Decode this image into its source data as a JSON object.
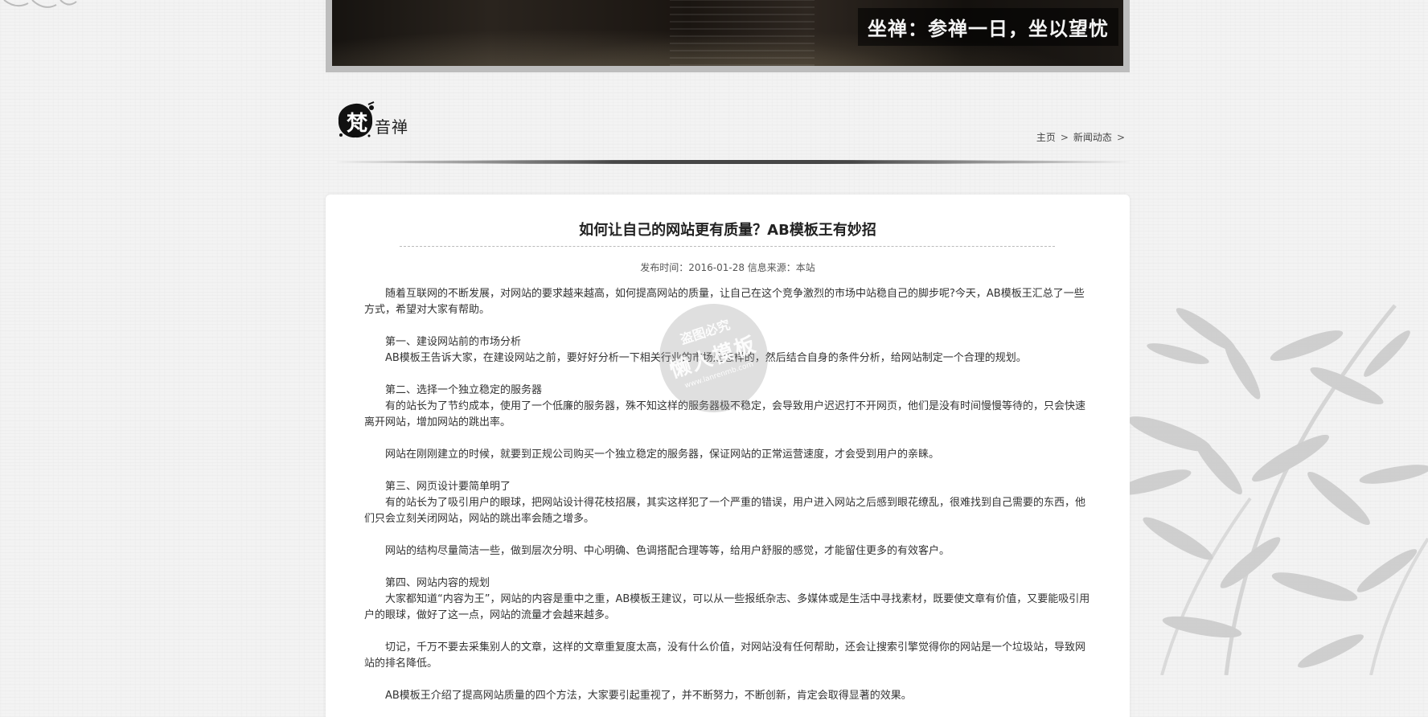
{
  "banner": {
    "caption": "坐禅：参禅一日，坐以望忧"
  },
  "logo": {
    "char": "梵",
    "text": "音禅"
  },
  "breadcrumb": {
    "items": [
      "主页",
      "新闻动态"
    ],
    "separator": ">"
  },
  "article": {
    "title": "如何让自己的网站更有质量？AB模板王有妙招",
    "meta": "发布时间：2016-01-28 信息来源：本站",
    "paragraphs": [
      {
        "text": "随着互联网的不断发展，对网站的要求越来越高，如何提高网站的质量，让自己在这个竞争激烈的市场中站稳自己的脚步呢?今天，AB模板王汇总了一些方式，希望对大家有帮助。",
        "gap": false
      },
      {
        "text": "第一、建设网站前的市场分析",
        "gap": true
      },
      {
        "text": "AB模板王告诉大家，在建设网站之前，要好好分析一下相关行业的市场是怎样的，然后结合自身的条件分析，给网站制定一个合理的规划。",
        "gap": false
      },
      {
        "text": "第二、选择一个独立稳定的服务器",
        "gap": true
      },
      {
        "text": "有的站长为了节约成本，使用了一个低廉的服务器，殊不知这样的服务器极不稳定，会导致用户迟迟打不开网页，他们是没有时间慢慢等待的，只会快速离开网站，增加网站的跳出率。",
        "gap": false
      },
      {
        "text": "网站在刚刚建立的时候，就要到正规公司购买一个独立稳定的服务器，保证网站的正常运营速度，才会受到用户的亲睐。",
        "gap": true
      },
      {
        "text": "第三、网页设计要简单明了",
        "gap": true
      },
      {
        "text": "有的站长为了吸引用户的眼球，把网站设计得花枝招展，其实这样犯了一个严重的错误，用户进入网站之后感到眼花缭乱，很难找到自己需要的东西，他们只会立刻关闭网站，网站的跳出率会随之增多。",
        "gap": false
      },
      {
        "text": "网站的结构尽量简洁一些，做到层次分明、中心明确、色调搭配合理等等，给用户舒服的感觉，才能留住更多的有效客户。",
        "gap": true
      },
      {
        "text": "第四、网站内容的规划",
        "gap": true
      },
      {
        "text": "大家都知道“内容为王”，网站的内容是重中之重，AB模板王建议，可以从一些报纸杂志、多媒体或是生活中寻找素材，既要使文章有价值，又要能吸引用户的眼球，做好了这一点，网站的流量才会越来越多。",
        "gap": false
      },
      {
        "text": "切记，千万不要去采集别人的文章，这样的文章重复度太高，没有什么价值，对网站没有任何帮助，还会让搜索引擎觉得你的网站是一个垃圾站，导致网站的排名降低。",
        "gap": true
      },
      {
        "text": "AB模板王介绍了提高网站质量的四个方法，大家要引起重视了，并不断努力，不断创新，肯定会取得显著的效果。",
        "gap": true
      }
    ]
  },
  "watermark": {
    "top": "盗图必究",
    "mid": "懒人模板",
    "url": "www.lanrenmb.com"
  }
}
